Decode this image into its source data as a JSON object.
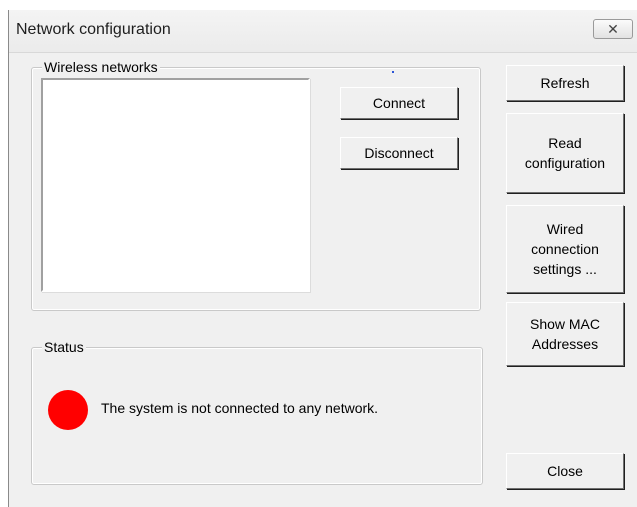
{
  "window": {
    "title": "Network configuration",
    "close_glyph": "✕"
  },
  "wireless_group": {
    "label": "Wireless networks",
    "networks": [],
    "connect_label": "Connect",
    "disconnect_label": "Disconnect"
  },
  "status_group": {
    "label": "Status",
    "message": "The system is not connected to any network.",
    "indicator_color": "#ff0000"
  },
  "side_buttons": {
    "refresh": "Refresh",
    "read_configuration": "Read\nconfiguration",
    "wired_settings": "Wired\nconnection\nsettings ...",
    "show_mac": "Show MAC\nAddresses",
    "close": "Close"
  }
}
